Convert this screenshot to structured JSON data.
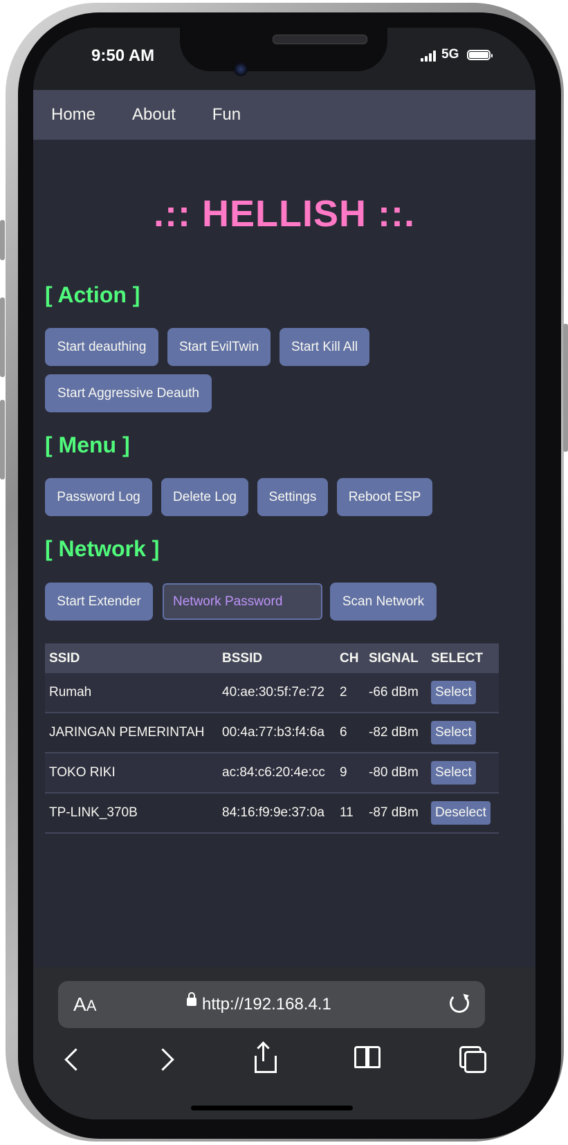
{
  "status_bar": {
    "time": "9:50 AM",
    "network": "5G"
  },
  "nav": {
    "items": [
      "Home",
      "About",
      "Fun"
    ]
  },
  "title": ".:: HELLISH ::.",
  "sections": {
    "action": "[ Action ]",
    "menu": "[ Menu ]",
    "network": "[ Network ]"
  },
  "action_buttons": [
    "Start deauthing",
    "Start EvilTwin",
    "Start Kill All",
    "Start Aggressive Deauth"
  ],
  "menu_buttons": [
    "Password Log",
    "Delete Log",
    "Settings",
    "Reboot ESP"
  ],
  "network_controls": {
    "extender_button": "Start Extender",
    "password_placeholder": "Network Password",
    "scan_button": "Scan Network"
  },
  "table": {
    "headers": [
      "SSID",
      "BSSID",
      "CH",
      "SIGNAL",
      "SELECT"
    ],
    "rows": [
      {
        "ssid": "Rumah",
        "bssid": "40:ae:30:5f:7e:72",
        "ch": "2",
        "signal": "-66 dBm",
        "action": "Select"
      },
      {
        "ssid": "JARINGAN PEMERINTAH",
        "bssid": "00:4a:77:b3:f4:6a",
        "ch": "6",
        "signal": "-82 dBm",
        "action": "Select"
      },
      {
        "ssid": "TOKO RIKI",
        "bssid": "ac:84:c6:20:4e:cc",
        "ch": "9",
        "signal": "-80 dBm",
        "action": "Select"
      },
      {
        "ssid": "TP-LINK_370B",
        "bssid": "84:16:f9:9e:37:0a",
        "ch": "11",
        "signal": "-87 dBm",
        "action": "Deselect"
      }
    ]
  },
  "browser": {
    "reader_label": "AA",
    "url": "http://192.168.4.1"
  },
  "colors": {
    "background": "#282a36",
    "nav_bg": "#44475a",
    "button": "#6272a4",
    "title_pink": "#ff79c6",
    "section_green": "#50fa7b",
    "placeholder_purple": "#bd93f9"
  }
}
